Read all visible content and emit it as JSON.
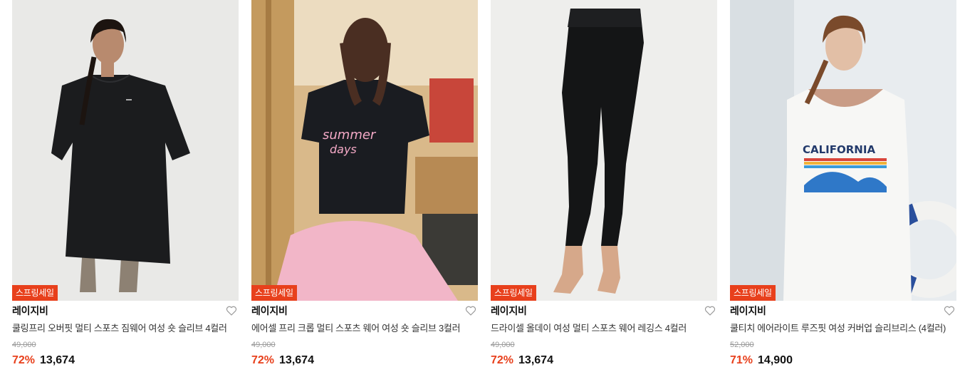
{
  "colors": {
    "accent": "#e8401c",
    "badge_text": "#ffffff",
    "original_price": "#9a9a9a"
  },
  "products": [
    {
      "badge": "스프링세일",
      "brand": "레이지비",
      "name": "쿨링프리 오버핏 멀티 스포츠 짐웨어 여성 숏 슬리브 4컬러",
      "original_price": "49,000",
      "discount": "72%",
      "price": "13,674",
      "wishlist_icon": "heart-outline-icon"
    },
    {
      "badge": "스프링세일",
      "brand": "레이지비",
      "name": "에어셀 프리 크롭 멀티 스포츠 웨어 여성 숏 슬리브 3컬러",
      "original_price": "49,000",
      "discount": "72%",
      "price": "13,674",
      "wishlist_icon": "heart-outline-icon"
    },
    {
      "badge": "스프링세일",
      "brand": "레이지비",
      "name": "드라이셀 올데이 여성 멀티 스포츠 웨어 레깅스 4컬러",
      "original_price": "49,000",
      "discount": "72%",
      "price": "13,674",
      "wishlist_icon": "heart-outline-icon"
    },
    {
      "badge": "스프링세일",
      "brand": "레이지비",
      "name": "쿨티치 에어라이트 루즈핏 여성 커버업 슬리브리스 (4컬러)",
      "original_price": "52,000",
      "discount": "71%",
      "price": "14,900",
      "wishlist_icon": "heart-outline-icon"
    }
  ]
}
